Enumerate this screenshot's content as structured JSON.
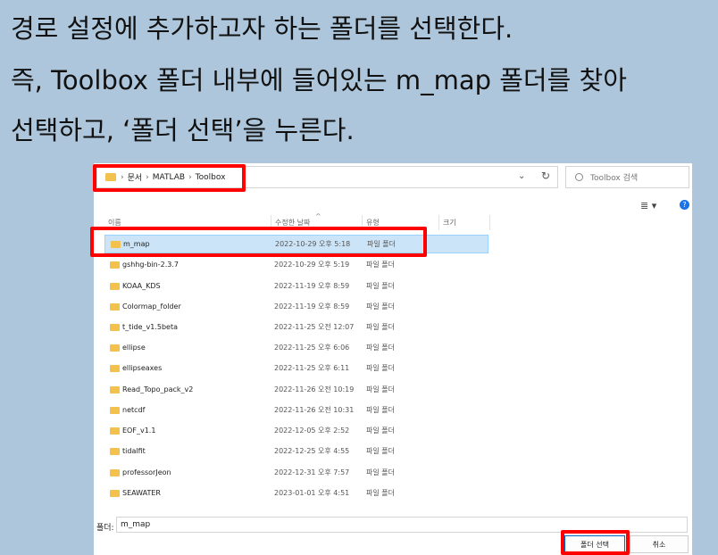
{
  "instructions": {
    "line1": "경로 설정에 추가하고자 하는 폴더를 선택한다.",
    "line2": "즉, Toolbox 폴더 내부에 들어있는 m_map 폴더를 찾아",
    "line3": "선택하고, ‘폴더 선택’을 누른다."
  },
  "breadcrumb": [
    "문서",
    "MATLAB",
    "Toolbox"
  ],
  "search_placeholder": "Toolbox 검색",
  "columns": {
    "name": "이름",
    "date": "수정한 날짜",
    "type": "유형",
    "size": "크기"
  },
  "folders": [
    {
      "name": "m_map",
      "date": "2022-10-29 오후 5:18",
      "type": "파일 폴더"
    },
    {
      "name": "gshhg-bin-2.3.7",
      "date": "2022-10-29 오후 5:19",
      "type": "파일 폴더"
    },
    {
      "name": "KOAA_KDS",
      "date": "2022-11-19 오후 8:59",
      "type": "파일 폴더"
    },
    {
      "name": "Colormap_folder",
      "date": "2022-11-19 오후 8:59",
      "type": "파일 폴더"
    },
    {
      "name": "t_tide_v1.5beta",
      "date": "2022-11-25 오전 12:07",
      "type": "파일 폴더"
    },
    {
      "name": "ellipse",
      "date": "2022-11-25 오후 6:06",
      "type": "파일 폴더"
    },
    {
      "name": "ellipseaxes",
      "date": "2022-11-25 오후 6:11",
      "type": "파일 폴더"
    },
    {
      "name": "Read_Topo_pack_v2",
      "date": "2022-11-26 오전 10:19",
      "type": "파일 폴더"
    },
    {
      "name": "netcdf",
      "date": "2022-11-26 오전 10:31",
      "type": "파일 폴더"
    },
    {
      "name": "EOF_v1.1",
      "date": "2022-12-05 오후 2:52",
      "type": "파일 폴더"
    },
    {
      "name": "tidalfit",
      "date": "2022-12-25 오후 4:55",
      "type": "파일 폴더"
    },
    {
      "name": "professorJeon",
      "date": "2022-12-31 오후 7:57",
      "type": "파일 폴더"
    },
    {
      "name": "SEAWATER",
      "date": "2023-01-01 오후 4:51",
      "type": "파일 폴더"
    }
  ],
  "folder_label": "폴더:",
  "folder_value": "m_map",
  "select_button": "폴더 선택",
  "cancel_button": "취소",
  "highlight_color": "#ff0000"
}
